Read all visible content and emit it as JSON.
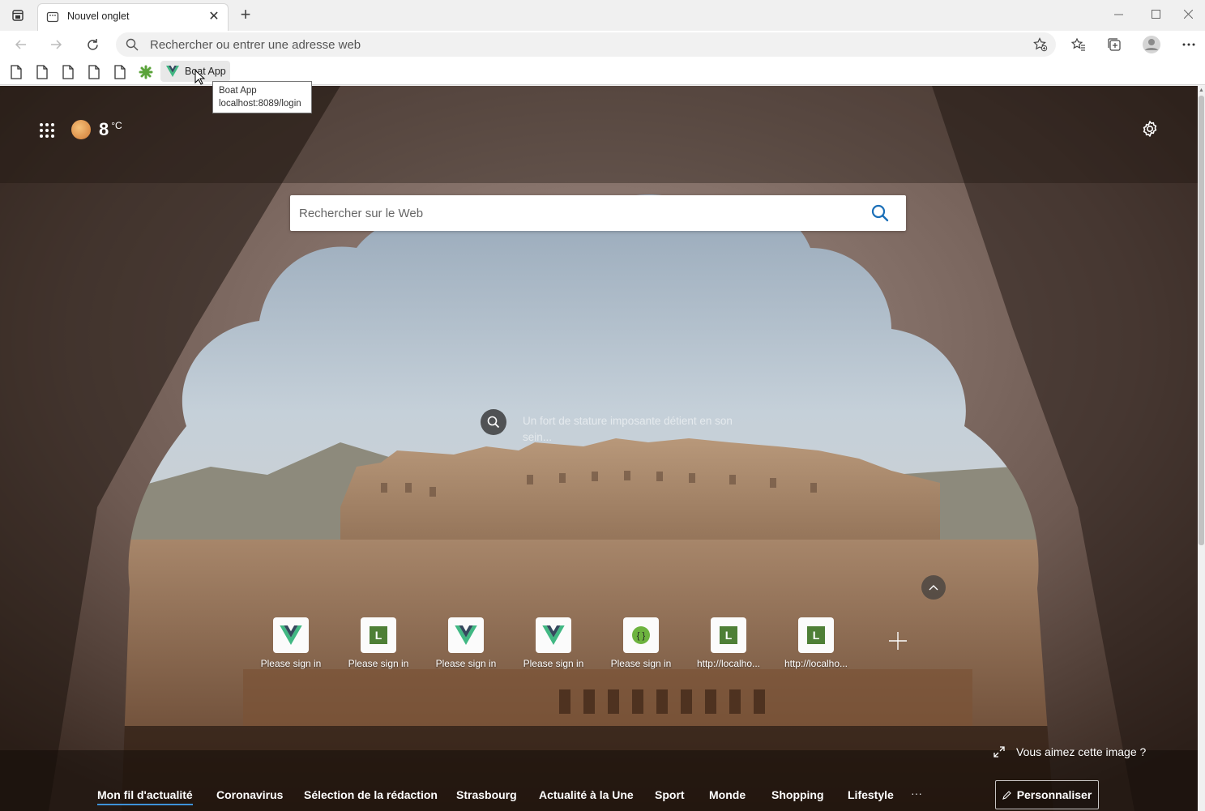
{
  "browser": {
    "tab": {
      "title": "Nouvel onglet",
      "close_glyph": "✕"
    },
    "new_tab_glyph": "+",
    "address_bar": {
      "placeholder": "Rechercher ou entrer une adresse web"
    },
    "bookmarks": {
      "page_icons": [
        "page-icon",
        "page-icon",
        "page-icon",
        "page-icon",
        "page-icon"
      ],
      "item": {
        "label": "Boat App",
        "icon": "vue-logo"
      },
      "tooltip": {
        "title": "Boat App",
        "url": "localhost:8089/login"
      }
    }
  },
  "newtab": {
    "weather": {
      "temperature": "8",
      "unit": "°C"
    },
    "search": {
      "placeholder": "Rechercher sur le Web"
    },
    "image_caption": "Un fort de stature imposante détient en son sein...",
    "quick_links": [
      {
        "label": "Please sign in",
        "icon": "vue-logo"
      },
      {
        "label": "Please sign in",
        "icon": "letter-l",
        "letter": "L"
      },
      {
        "label": "Please sign in",
        "icon": "vue-logo"
      },
      {
        "label": "Please sign in",
        "icon": "vue-logo"
      },
      {
        "label": "Please sign in",
        "icon": "spring-logo"
      },
      {
        "label": "http://localho...",
        "icon": "letter-l",
        "letter": "L"
      },
      {
        "label": "http://localho...",
        "icon": "letter-l",
        "letter": "L"
      }
    ],
    "like_image": "Vous aimez cette image ?",
    "feed_tabs": [
      "Mon fil d'actualité",
      "Coronavirus",
      "Sélection de la rédaction",
      "Strasbourg",
      "Actualité à la Une",
      "Sport",
      "Monde",
      "Shopping",
      "Lifestyle"
    ],
    "feed_more": "···",
    "personalize": "Personnaliser"
  },
  "colors": {
    "accent": "#3e92d8",
    "tile_green": "#4e7f36",
    "vue_green": "#41b883",
    "vue_dark": "#35495e"
  }
}
